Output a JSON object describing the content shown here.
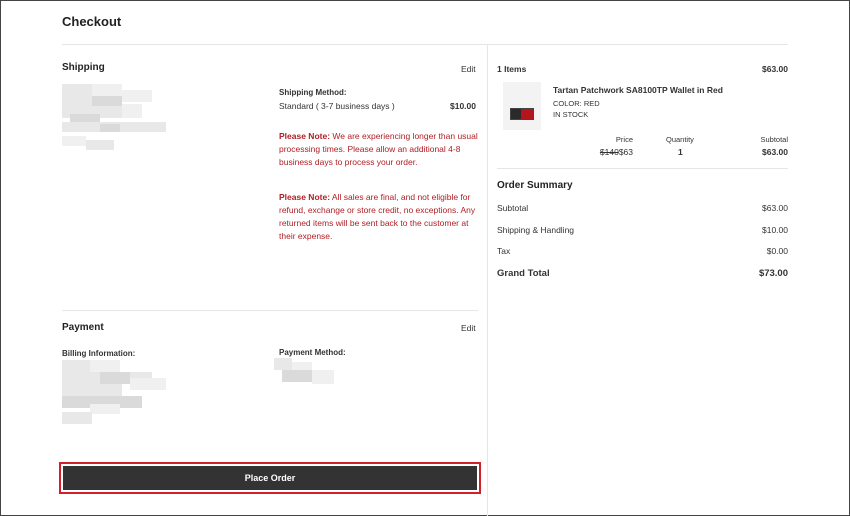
{
  "page": {
    "title": "Checkout"
  },
  "shipping": {
    "title": "Shipping",
    "edit_label": "Edit",
    "method_label": "Shipping Method:",
    "method_value": "Standard ( 3-7 business days )",
    "method_price": "$10.00",
    "note1_prefix": "Please Note:",
    "note1_text": " We are experiencing longer than usual processing times. Please allow an additional 4-8 business days to process your order.",
    "note2_prefix": "Please Note:",
    "note2_text": " All sales are final, and not eligible for refund, exchange or store credit, no exceptions. Any returned items will be sent back to the customer at their expense."
  },
  "payment": {
    "title": "Payment",
    "edit_label": "Edit",
    "billing_label": "Billing Information:",
    "method_label": "Payment Method:"
  },
  "place_order": {
    "label": "Place Order"
  },
  "cart": {
    "items_count": "1 Items",
    "items_total": "$63.00",
    "item": {
      "name": "Tartan Patchwork SA8100TP Wallet in Red",
      "color": "COLOR: RED",
      "stock": "IN STOCK",
      "price_label": "Price",
      "qty_label": "Quantity",
      "subtotal_label": "Subtotal",
      "old_price": "$140",
      "price": "$63",
      "qty": "1",
      "subtotal": "$63.00"
    }
  },
  "summary": {
    "title": "Order Summary",
    "rows": [
      {
        "label": "Subtotal",
        "value": "$63.00"
      },
      {
        "label": "Shipping & Handling",
        "value": "$10.00"
      },
      {
        "label": "Tax",
        "value": "$0.00"
      }
    ],
    "grand_label": "Grand Total",
    "grand_value": "$73.00"
  },
  "colors": {
    "accent": "#b01e24",
    "button": "#333333",
    "highlight": "#d0202a"
  }
}
